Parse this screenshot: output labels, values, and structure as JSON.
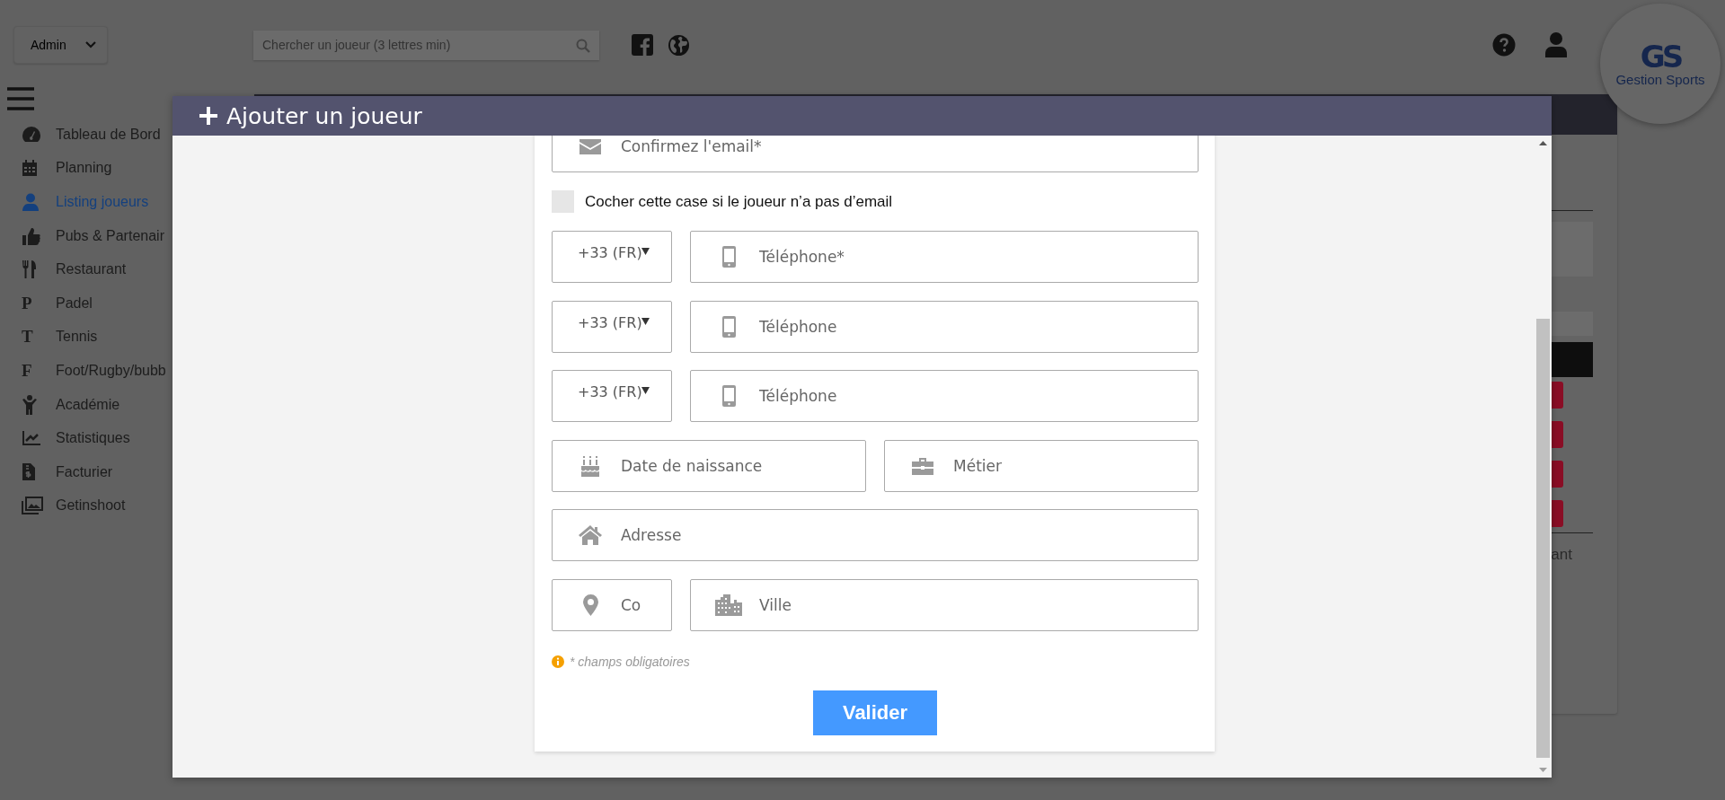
{
  "topbar": {
    "role_select": {
      "value": "Admin"
    },
    "search": {
      "placeholder": "Chercher un joueur (3 lettres min)"
    },
    "logo": {
      "mark": "GS",
      "text": "Gestion Sports"
    }
  },
  "sidebar": {
    "items": [
      {
        "label": "Tableau de Bord",
        "selected": false
      },
      {
        "label": "Planning",
        "selected": false
      },
      {
        "label": "Listing joueurs",
        "selected": true
      },
      {
        "label": "Pubs & Partenair",
        "selected": false
      },
      {
        "label": "Restaurant",
        "selected": false
      },
      {
        "label": "Padel",
        "glyph": "P",
        "selected": false
      },
      {
        "label": "Tennis",
        "glyph": "T",
        "selected": false
      },
      {
        "label": "Foot/Rugby/bubb",
        "glyph": "F",
        "selected": false
      },
      {
        "label": "Académie",
        "selected": false
      },
      {
        "label": "Statistiques",
        "selected": false
      },
      {
        "label": "Facturier",
        "selected": false
      },
      {
        "label": "Getinshoot",
        "selected": false
      }
    ]
  },
  "background_card": {
    "text": "ant"
  },
  "modal": {
    "title": "Ajouter un joueur",
    "rows": [
      {
        "kind": "fields",
        "items": [
          {
            "kind": "input",
            "placeholder": "Confirmez l'email*"
          }
        ]
      },
      {
        "kind": "checkbox",
        "label": "Cocher cette case si le joueur n’a pas d’email",
        "checked": false
      },
      {
        "kind": "fields",
        "items": [
          {
            "kind": "select",
            "value": "+33 (FR)"
          },
          {
            "kind": "input",
            "placeholder": "Téléphone*"
          }
        ]
      },
      {
        "kind": "fields",
        "items": [
          {
            "kind": "select",
            "value": "+33 (FR)"
          },
          {
            "kind": "input",
            "placeholder": "Téléphone"
          }
        ]
      },
      {
        "kind": "fields",
        "items": [
          {
            "kind": "select",
            "value": "+33 (FR)"
          },
          {
            "kind": "input",
            "placeholder": "Téléphone"
          }
        ]
      },
      {
        "kind": "fields",
        "items": [
          {
            "kind": "input",
            "placeholder": "Date de naissance"
          },
          {
            "kind": "input",
            "placeholder": "Métier"
          }
        ]
      },
      {
        "kind": "fields",
        "items": [
          {
            "kind": "input",
            "placeholder": "Adresse"
          }
        ]
      },
      {
        "kind": "fields",
        "items": [
          {
            "kind": "input",
            "placeholder": "Co"
          },
          {
            "kind": "input",
            "placeholder": "Ville"
          }
        ]
      }
    ],
    "note": "* champs obligatoires",
    "submit": "Valider"
  }
}
